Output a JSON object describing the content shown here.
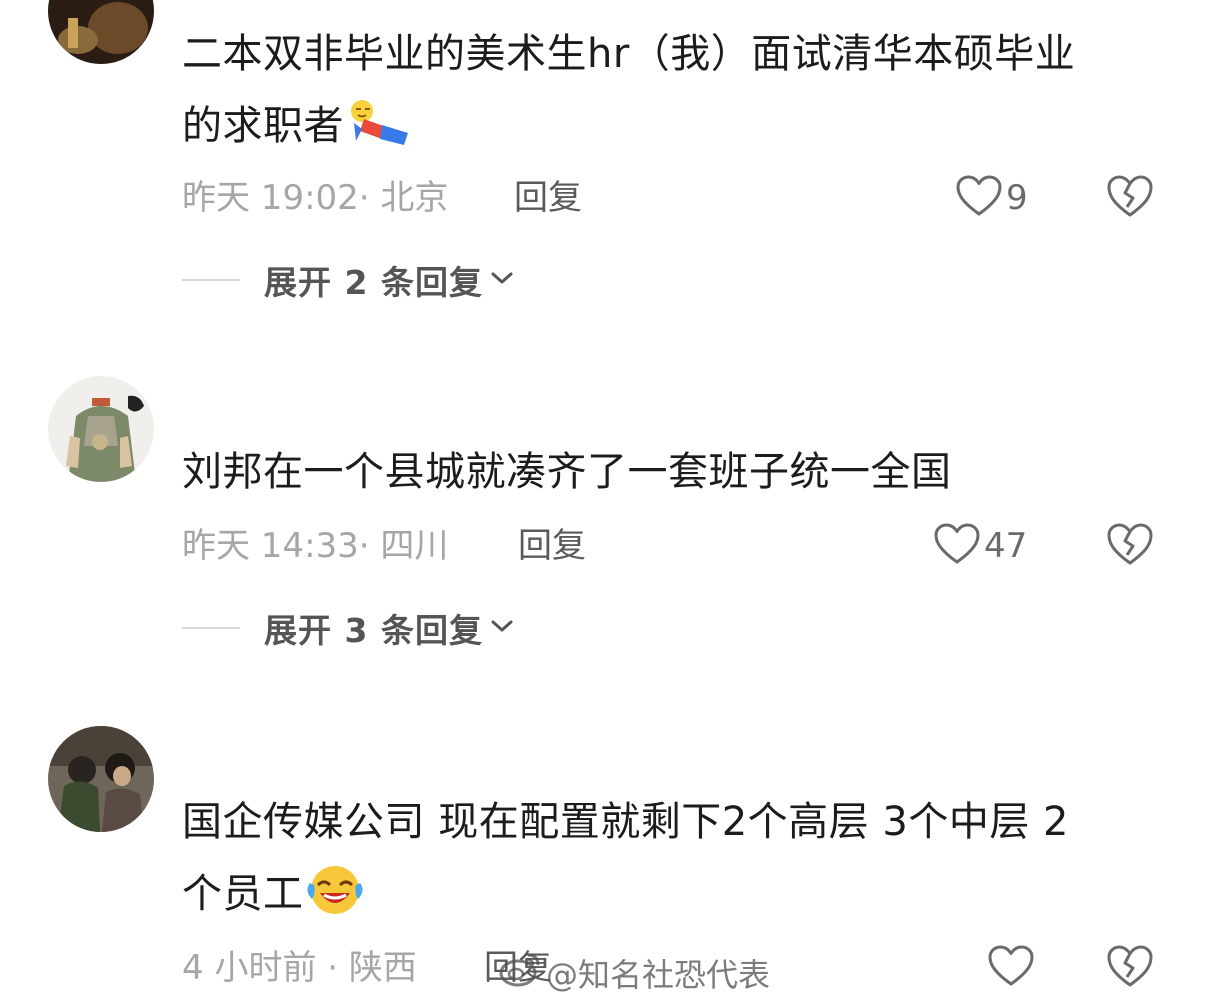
{
  "colors": {
    "text": "#1c1c1c",
    "meta": "#a6a6a6",
    "action": "#5a5a5a",
    "divider": "#d6d6d6"
  },
  "comments": [
    {
      "avatar": "avatar-dark-photo",
      "text": "二本双非毕业的美术生hr（我）面试清华本硕毕业的求职者",
      "text_line1": "二本双非毕业的美术生hr（我）面试清华本硕毕业",
      "text_line2": "的求职者",
      "emoji": "lying-down-emoji-icon",
      "time_location": "昨天 19:02· 北京",
      "reply_label": "回复",
      "likes": "9",
      "expand_label": "展开 2 条回复"
    },
    {
      "avatar": "avatar-cartoon-soldier",
      "text": "刘邦在一个县城就凑齐了一套班子统一全国",
      "time_location": "昨天 14:33· 四川",
      "reply_label": "回复",
      "likes": "47",
      "expand_label": "展开 3 条回复"
    },
    {
      "avatar": "avatar-film-still",
      "text": "国企传媒公司 现在配置就剩下2个高层  3个中层 2个员工",
      "text_line1": "国企传媒公司 现在配置就剩下2个高层  3个中层 2",
      "text_line2": "个员工",
      "emoji": "laughing-crying-emoji-icon",
      "time_location": "4 小时前 · 陕西",
      "reply_label": "回复",
      "likes": ""
    }
  ],
  "watermark": {
    "text": "@知名社恐代表",
    "logo": "weibo-logo-icon"
  }
}
